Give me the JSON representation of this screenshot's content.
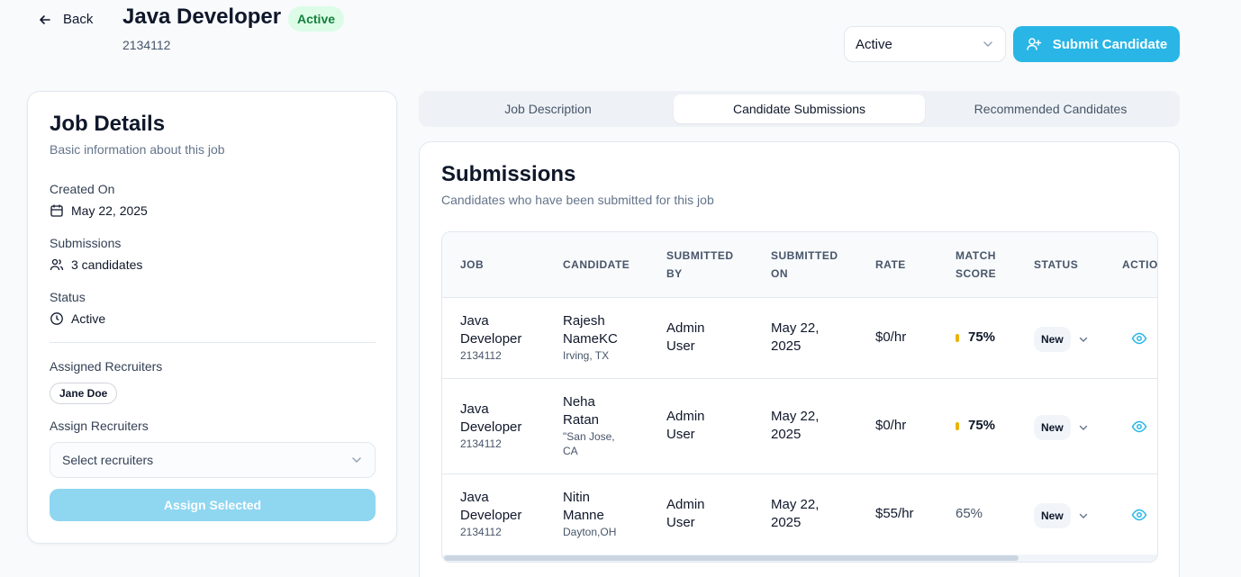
{
  "header": {
    "back_label": "Back",
    "title": "Java Developer",
    "status_badge": "Active",
    "job_id": "2134112",
    "status_select": "Active",
    "submit_label": "Submit Candidate"
  },
  "job_details": {
    "title": "Job Details",
    "subtitle": "Basic information about this job",
    "created_on_label": "Created On",
    "created_on": "May 22, 2025",
    "submissions_label": "Submissions",
    "submissions": "3 candidates",
    "status_label": "Status",
    "status": "Active",
    "assigned_label": "Assigned Recruiters",
    "assigned": [
      "Jane Doe"
    ],
    "assign_label": "Assign Recruiters",
    "assign_placeholder": "Select recruiters",
    "assign_button": "Assign Selected"
  },
  "tabs": [
    {
      "label": "Job Description",
      "active": false
    },
    {
      "label": "Candidate Submissions",
      "active": true
    },
    {
      "label": "Recommended Candidates",
      "active": false
    }
  ],
  "submissions": {
    "title": "Submissions",
    "subtitle": "Candidates who have been submitted for this job",
    "columns": [
      "JOB",
      "CANDIDATE",
      "SUBMITTED\nBY",
      "SUBMITTED\nON",
      "RATE",
      "MATCH\nSCORE",
      "STATUS",
      "ACTIONS"
    ],
    "rows": [
      {
        "job": "Java\nDeveloper",
        "job_id": "2134112",
        "candidate": "Rajesh\nNameKC",
        "location": "Irving, TX",
        "submitted_by": "Admin\nUser",
        "submitted_on": "May 22,\n2025",
        "rate": "$0/hr",
        "score": "75%",
        "score_highlight": true,
        "status": "New"
      },
      {
        "job": "Java\nDeveloper",
        "job_id": "2134112",
        "candidate": "Neha\nRatan",
        "location": "\"San Jose,\nCA",
        "submitted_by": "Admin\nUser",
        "submitted_on": "May 22,\n2025",
        "rate": "$0/hr",
        "score": "75%",
        "score_highlight": true,
        "status": "New"
      },
      {
        "job": "Java\nDeveloper",
        "job_id": "2134112",
        "candidate": "Nitin\nManne",
        "location": "Dayton,OH",
        "submitted_by": "Admin\nUser",
        "submitted_on": "May 22,\n2025",
        "rate": "$55/hr",
        "score": "65%",
        "score_highlight": false,
        "status": "New"
      }
    ]
  },
  "colors": {
    "accent": "#29b6e6",
    "accent_disabled": "#8fd6f1",
    "active_badge_bg": "#dcfce7",
    "active_badge_text": "#15803d",
    "score_bar": "#eab308",
    "eye_icon": "#29b6e6"
  }
}
